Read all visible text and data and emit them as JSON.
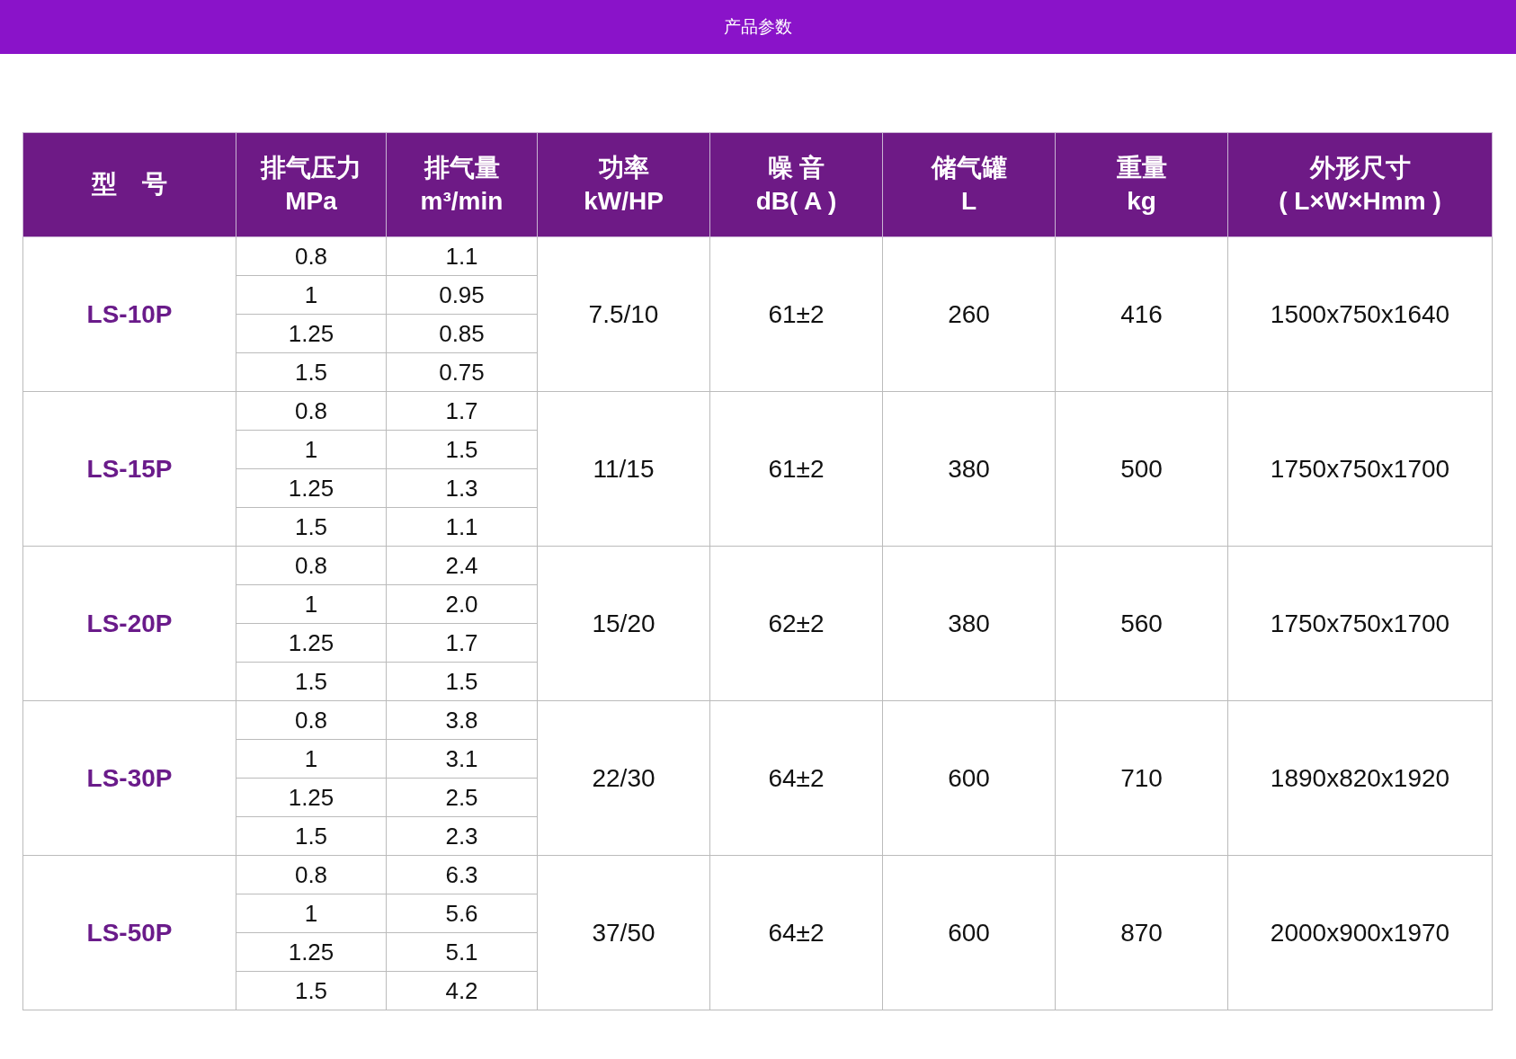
{
  "top_bar": {
    "title": "产品参数"
  },
  "table": {
    "columns": [
      {
        "lines": [
          "型　号"
        ]
      },
      {
        "lines": [
          "排气压力",
          "MPa"
        ]
      },
      {
        "lines": [
          "排气量",
          "m³/min"
        ]
      },
      {
        "lines": [
          "功率",
          "kW/HP"
        ]
      },
      {
        "lines": [
          "噪 音",
          "dB( A )"
        ]
      },
      {
        "lines": [
          "储气罐",
          "L"
        ]
      },
      {
        "lines": [
          "重量",
          "kg"
        ]
      },
      {
        "lines": [
          "外形尺寸",
          "( L×W×Hmm )"
        ]
      }
    ],
    "rows": [
      {
        "model": "LS-10P",
        "pressure": [
          "0.8",
          "1",
          "1.25",
          "1.5"
        ],
        "flow": [
          "1.1",
          "0.95",
          "0.85",
          "0.75"
        ],
        "power": "7.5/10",
        "noise": "61±2",
        "tank": "260",
        "weight": "416",
        "size": "1500x750x1640"
      },
      {
        "model": "LS-15P",
        "pressure": [
          "0.8",
          "1",
          "1.25",
          "1.5"
        ],
        "flow": [
          "1.7",
          "1.5",
          "1.3",
          "1.1"
        ],
        "power": "11/15",
        "noise": "61±2",
        "tank": "380",
        "weight": "500",
        "size": "1750x750x1700"
      },
      {
        "model": "LS-20P",
        "pressure": [
          "0.8",
          "1",
          "1.25",
          "1.5"
        ],
        "flow": [
          "2.4",
          "2.0",
          "1.7",
          "1.5"
        ],
        "power": "15/20",
        "noise": "62±2",
        "tank": "380",
        "weight": "560",
        "size": "1750x750x1700"
      },
      {
        "model": "LS-30P",
        "pressure": [
          "0.8",
          "1",
          "1.25",
          "1.5"
        ],
        "flow": [
          "3.8",
          "3.1",
          "2.5",
          "2.3"
        ],
        "power": "22/30",
        "noise": "64±2",
        "tank": "600",
        "weight": "710",
        "size": "1890x820x1920"
      },
      {
        "model": "LS-50P",
        "pressure": [
          "0.8",
          "1",
          "1.25",
          "1.5"
        ],
        "flow": [
          "6.3",
          "5.6",
          "5.1",
          "4.2"
        ],
        "power": "37/50",
        "noise": "64±2",
        "tank": "600",
        "weight": "870",
        "size": "2000x900x1970"
      }
    ]
  }
}
